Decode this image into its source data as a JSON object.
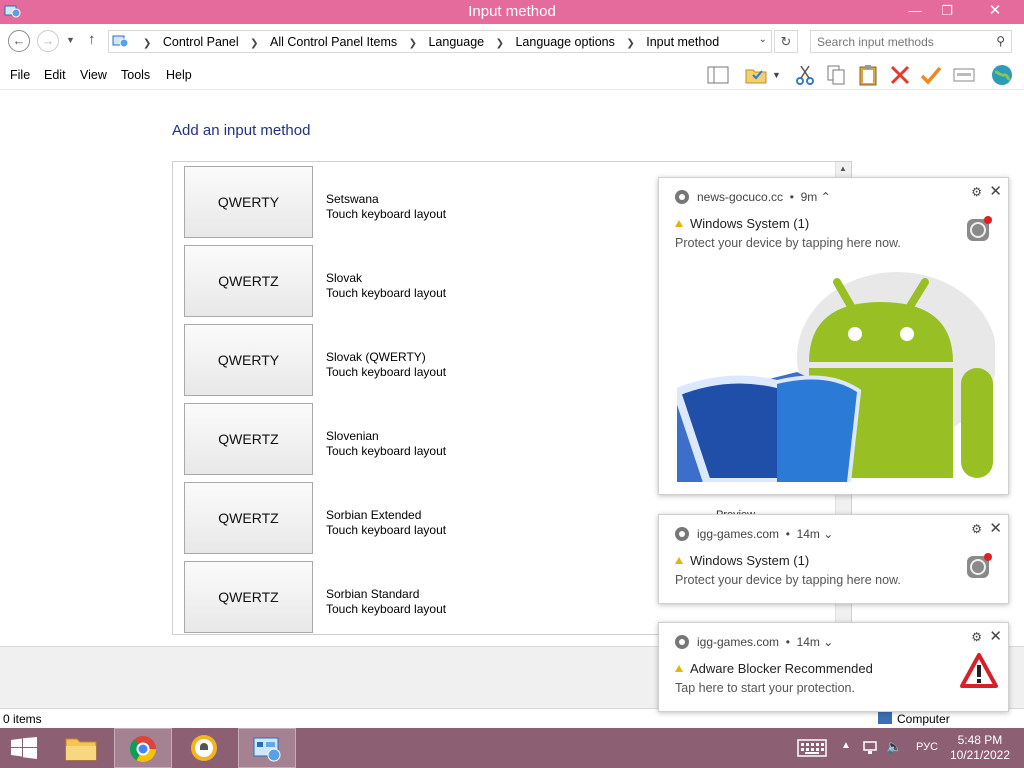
{
  "window": {
    "title": "Input method"
  },
  "address": {
    "breadcrumb": [
      "Control Panel",
      "All Control Panel Items",
      "Language",
      "Language options",
      "Input method"
    ],
    "search_placeholder": "Search input methods"
  },
  "menu": {
    "items": [
      "File",
      "Edit",
      "View",
      "Tools",
      "Help"
    ]
  },
  "main": {
    "heading": "Add an input method",
    "layouts": [
      {
        "key": "QWERTY",
        "name": "Setswana",
        "desc": "Touch keyboard layout"
      },
      {
        "key": "QWERTZ",
        "name": "Slovak",
        "desc": "Touch keyboard layout"
      },
      {
        "key": "QWERTY",
        "name": "Slovak (QWERTY)",
        "desc": "Touch keyboard layout"
      },
      {
        "key": "QWERTZ",
        "name": "Slovenian",
        "desc": "Touch keyboard layout"
      },
      {
        "key": "QWERTZ",
        "name": "Sorbian Extended",
        "desc": "Touch keyboard layout"
      },
      {
        "key": "QWERTZ",
        "name": "Sorbian Standard",
        "desc": "Touch keyboard layout"
      }
    ],
    "partial_text": "Preview"
  },
  "status": {
    "left": "0 items",
    "right": "Computer"
  },
  "notifications": [
    {
      "source": "news-gocuco.cc",
      "age": "9m",
      "chevron": "⌃",
      "title": "Windows System (1)",
      "body": "Protect your device by tapping here now.",
      "icon": "android-shield-image"
    },
    {
      "source": "igg-games.com",
      "age": "14m",
      "chevron": "⌄",
      "title": "Windows System (1)",
      "body": "Protect your device by tapping here now.",
      "icon": "settings-badge-icon"
    },
    {
      "source": "igg-games.com",
      "age": "14m",
      "chevron": "⌄",
      "title": "Adware Blocker Recommended",
      "body": "Tap here to start your protection.",
      "icon": "warning-triangle-icon"
    }
  ],
  "taskbar": {
    "lang": "РУС",
    "time": "5:48 PM",
    "date": "10/21/2022"
  },
  "colors": {
    "titlebar": "#e46b9c",
    "taskbar": "#8c5f73",
    "heading": "#1e3287",
    "android": "#98c024"
  }
}
